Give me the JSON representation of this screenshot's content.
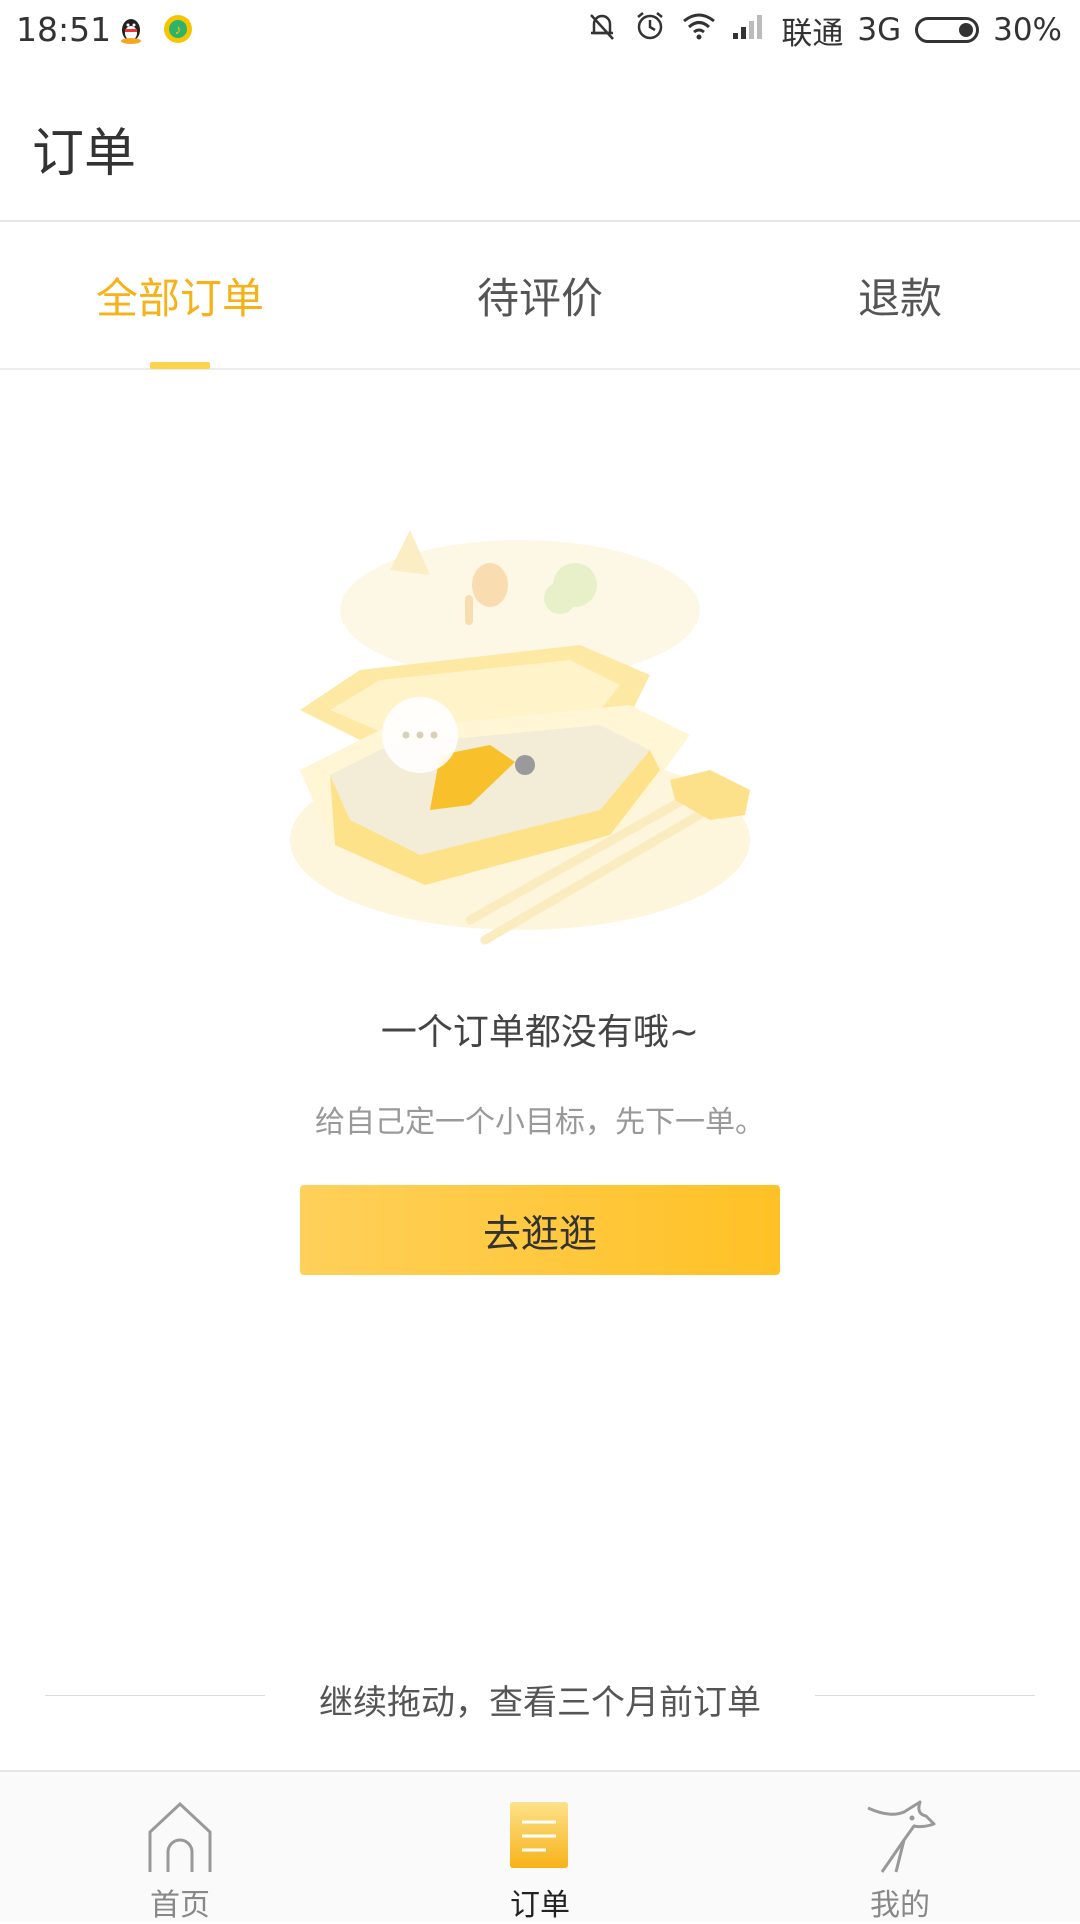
{
  "status_bar": {
    "time": "18:51",
    "carrier": "联通",
    "network": "3G",
    "battery": "30%",
    "icons": [
      "qq-icon",
      "music-app-icon",
      "mute-bell-icon",
      "alarm-icon",
      "wifi-icon",
      "signal-icon",
      "battery-icon"
    ]
  },
  "header": {
    "title": "订单"
  },
  "tabs": [
    {
      "label": "全部订单",
      "active": true
    },
    {
      "label": "待评价",
      "active": false
    },
    {
      "label": "退款",
      "active": false
    }
  ],
  "empty_state": {
    "title": "一个订单都没有哦~",
    "subtitle": "给自己定一个小目标，先下一单。",
    "button_label": "去逛逛"
  },
  "older_orders_hint": "继续拖动，查看三个月前订单",
  "bottom_nav": {
    "items": [
      {
        "label": "首页",
        "icon": "home-icon",
        "active": false
      },
      {
        "label": "订单",
        "icon": "order-list-icon",
        "active": true
      },
      {
        "label": "我的",
        "icon": "profile-deer-icon",
        "active": false
      }
    ]
  },
  "colors": {
    "accent": "#f7b219",
    "button_start": "#ffd05a",
    "button_end": "#ffc125",
    "indicator": "#fcd34d"
  }
}
